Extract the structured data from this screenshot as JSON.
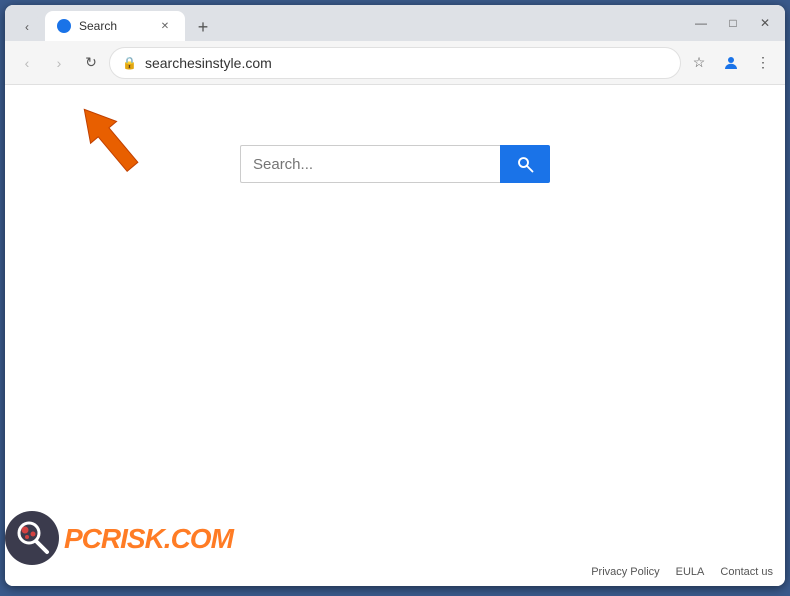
{
  "browser": {
    "tab": {
      "title": "Search",
      "favicon_color": "#1a73e8"
    },
    "new_tab_label": "+",
    "controls": {
      "minimize": "—",
      "maximize": "□",
      "close": "✕"
    },
    "nav": {
      "back_label": "‹",
      "forward_label": "›",
      "refresh_label": "↻",
      "address": "searchesinstyle.com",
      "address_icon": "🔒",
      "bookmark_icon": "☆",
      "profile_icon": "👤",
      "menu_icon": "⋮"
    }
  },
  "page": {
    "search_placeholder": "Search...",
    "search_button_icon": "🔍"
  },
  "footer": {
    "privacy_policy": "Privacy Policy",
    "eula": "EULA",
    "contact_us": "Contact us"
  },
  "watermark": {
    "brand": "PC",
    "brand_suffix": "risk.com"
  }
}
